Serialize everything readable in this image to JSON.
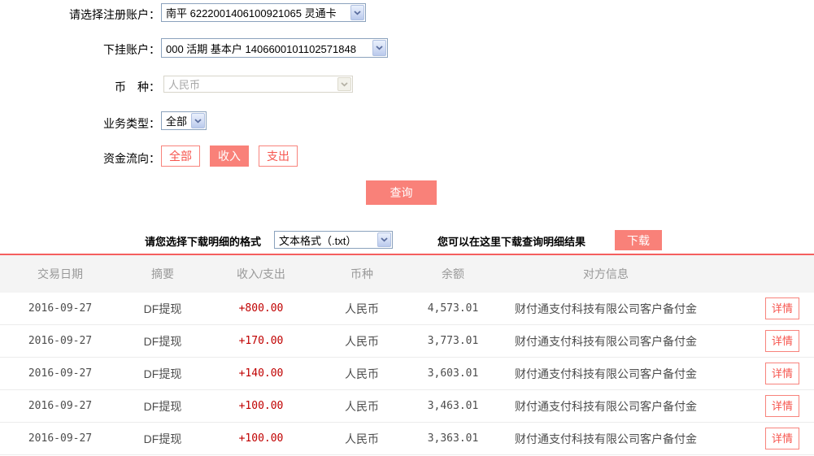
{
  "form": {
    "register_account": {
      "label": "请选择注册账户：",
      "value": "南平 6222001406100921065 灵通卡"
    },
    "sub_account": {
      "label": "下挂账户：",
      "value": "000 活期 基本户 1406600101102571848"
    },
    "currency": {
      "label": "币　种：",
      "value": "人民币"
    },
    "business_type": {
      "label": "业务类型：",
      "value": "全部"
    },
    "fund_flow": {
      "label": "资金流向：",
      "options": [
        "全部",
        "收入",
        "支出"
      ],
      "selected": "收入"
    },
    "query_button": "查询"
  },
  "download": {
    "format_label": "请您选择下载明细的格式",
    "format_value": "文本格式（.txt）",
    "hint": "您可以在这里下载查询明细结果",
    "button": "下载"
  },
  "table": {
    "headers": [
      "交易日期",
      "摘要",
      "收入/支出",
      "币种",
      "余额",
      "对方信息"
    ],
    "detail_button": "详情",
    "rows": [
      {
        "date": "2016-09-27",
        "summary": "DF提现",
        "amount": "+800.00",
        "currency": "人民币",
        "balance": "4,573.01",
        "counterparty": "财付通支付科技有限公司客户备付金"
      },
      {
        "date": "2016-09-27",
        "summary": "DF提现",
        "amount": "+170.00",
        "currency": "人民币",
        "balance": "3,773.01",
        "counterparty": "财付通支付科技有限公司客户备付金"
      },
      {
        "date": "2016-09-27",
        "summary": "DF提现",
        "amount": "+140.00",
        "currency": "人民币",
        "balance": "3,603.01",
        "counterparty": "财付通支付科技有限公司客户备付金"
      },
      {
        "date": "2016-09-27",
        "summary": "DF提现",
        "amount": "+100.00",
        "currency": "人民币",
        "balance": "3,463.01",
        "counterparty": "财付通支付科技有限公司客户备付金"
      },
      {
        "date": "2016-09-27",
        "summary": "DF提现",
        "amount": "+100.00",
        "currency": "人民币",
        "balance": "3,363.01",
        "counterparty": "财付通支付科技有限公司客户备付金"
      }
    ]
  },
  "colors": {
    "accent_salmon": "#f98179",
    "amount_red": "#c00000",
    "table_top_line": "#f55f5f"
  }
}
